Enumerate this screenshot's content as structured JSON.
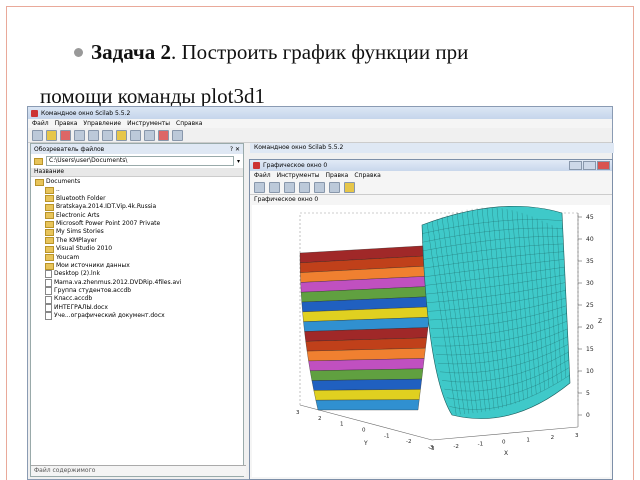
{
  "slide": {
    "bold": "Задача 2",
    "line1": ". Построить график функции  при",
    "line2": "помощи команды plot3d1"
  },
  "console_window": {
    "title": "Командное окно Scilab 5.5.2",
    "menu": [
      "Файл",
      "Правка",
      "Управление",
      "Инструменты",
      "Справка"
    ]
  },
  "file_browser": {
    "title": "Обозреватель файлов",
    "path": "C:\\Users\\user\\Documents\\",
    "column": "Название",
    "items": [
      {
        "name": "Documents",
        "type": "folder"
      },
      {
        "name": "..",
        "type": "folder"
      },
      {
        "name": "Bluetooth Folder",
        "type": "folder"
      },
      {
        "name": "Bratskaya.2014.IDT.Vip.4k.Russia",
        "type": "folder"
      },
      {
        "name": "Electronic Arts",
        "type": "folder"
      },
      {
        "name": "Microsoft Power Point 2007 Private",
        "type": "folder"
      },
      {
        "name": "My Sims Stories",
        "type": "folder"
      },
      {
        "name": "The KMPlayer",
        "type": "folder"
      },
      {
        "name": "Visual Studio 2010",
        "type": "folder"
      },
      {
        "name": "Youcam",
        "type": "folder"
      },
      {
        "name": "Мои источники данных",
        "type": "folder"
      },
      {
        "name": "Desktop (2).lnk",
        "type": "file"
      },
      {
        "name": "Mama.va.zhenmus.2012.DVDRip.4files.avi",
        "type": "file"
      },
      {
        "name": "Группа студентов.accdb",
        "type": "file"
      },
      {
        "name": "Класс.accdb",
        "type": "file"
      },
      {
        "name": "ИНТЕГРАЛЫ.docx",
        "type": "file"
      },
      {
        "name": "Уче...ографический документ.docx",
        "type": "file"
      }
    ],
    "footer": "Файл содержимого"
  },
  "console_panel": {
    "title": "Командное окно Scilab 5.5.2"
  },
  "graphic_window": {
    "title": "Графическое окно 0",
    "menu": [
      "Файл",
      "Инструменты",
      "Правка",
      "Справка"
    ],
    "tab": "Графическое окно 0"
  },
  "axes": {
    "z_ticks": [
      "45",
      "40",
      "35",
      "30",
      "25",
      "20",
      "15",
      "10",
      "5",
      "0"
    ],
    "z_label": "Z",
    "y_ticks": [
      "3",
      "2",
      "1",
      "0",
      "-1",
      "-2",
      "-3"
    ],
    "y_label": "Y",
    "x_ticks": [
      "-3",
      "-2",
      "-1",
      "0",
      "1",
      "2",
      "3"
    ],
    "x_label": "X"
  },
  "colors": {
    "surface_left": [
      "#a02828",
      "#c0401a",
      "#f08030",
      "#c050c0",
      "#60a040",
      "#2060c0",
      "#e0d020",
      "#3090d0"
    ],
    "surface_right": "#3fc9c9",
    "mesh": "#1a5a5a"
  }
}
